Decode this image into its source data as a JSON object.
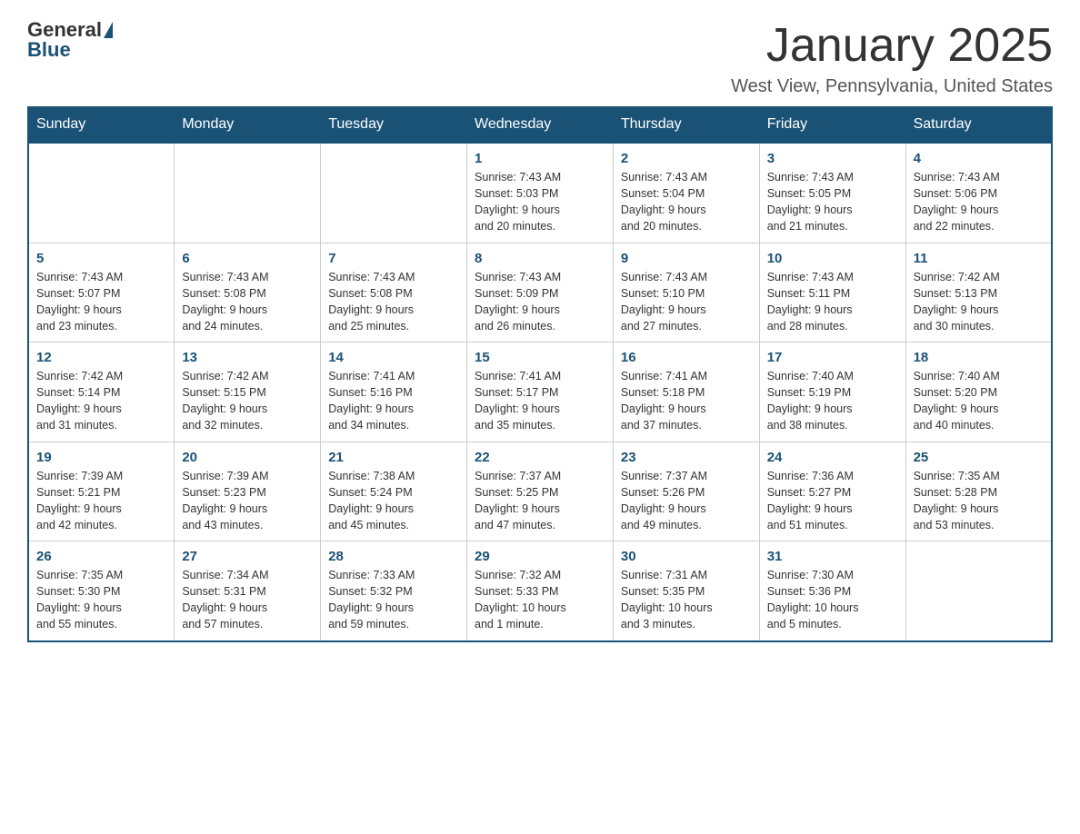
{
  "header": {
    "logo_general": "General",
    "logo_blue": "Blue",
    "title": "January 2025",
    "subtitle": "West View, Pennsylvania, United States"
  },
  "days_of_week": [
    "Sunday",
    "Monday",
    "Tuesday",
    "Wednesday",
    "Thursday",
    "Friday",
    "Saturday"
  ],
  "weeks": [
    [
      {
        "day": "",
        "info": ""
      },
      {
        "day": "",
        "info": ""
      },
      {
        "day": "",
        "info": ""
      },
      {
        "day": "1",
        "info": "Sunrise: 7:43 AM\nSunset: 5:03 PM\nDaylight: 9 hours\nand 20 minutes."
      },
      {
        "day": "2",
        "info": "Sunrise: 7:43 AM\nSunset: 5:04 PM\nDaylight: 9 hours\nand 20 minutes."
      },
      {
        "day": "3",
        "info": "Sunrise: 7:43 AM\nSunset: 5:05 PM\nDaylight: 9 hours\nand 21 minutes."
      },
      {
        "day": "4",
        "info": "Sunrise: 7:43 AM\nSunset: 5:06 PM\nDaylight: 9 hours\nand 22 minutes."
      }
    ],
    [
      {
        "day": "5",
        "info": "Sunrise: 7:43 AM\nSunset: 5:07 PM\nDaylight: 9 hours\nand 23 minutes."
      },
      {
        "day": "6",
        "info": "Sunrise: 7:43 AM\nSunset: 5:08 PM\nDaylight: 9 hours\nand 24 minutes."
      },
      {
        "day": "7",
        "info": "Sunrise: 7:43 AM\nSunset: 5:08 PM\nDaylight: 9 hours\nand 25 minutes."
      },
      {
        "day": "8",
        "info": "Sunrise: 7:43 AM\nSunset: 5:09 PM\nDaylight: 9 hours\nand 26 minutes."
      },
      {
        "day": "9",
        "info": "Sunrise: 7:43 AM\nSunset: 5:10 PM\nDaylight: 9 hours\nand 27 minutes."
      },
      {
        "day": "10",
        "info": "Sunrise: 7:43 AM\nSunset: 5:11 PM\nDaylight: 9 hours\nand 28 minutes."
      },
      {
        "day": "11",
        "info": "Sunrise: 7:42 AM\nSunset: 5:13 PM\nDaylight: 9 hours\nand 30 minutes."
      }
    ],
    [
      {
        "day": "12",
        "info": "Sunrise: 7:42 AM\nSunset: 5:14 PM\nDaylight: 9 hours\nand 31 minutes."
      },
      {
        "day": "13",
        "info": "Sunrise: 7:42 AM\nSunset: 5:15 PM\nDaylight: 9 hours\nand 32 minutes."
      },
      {
        "day": "14",
        "info": "Sunrise: 7:41 AM\nSunset: 5:16 PM\nDaylight: 9 hours\nand 34 minutes."
      },
      {
        "day": "15",
        "info": "Sunrise: 7:41 AM\nSunset: 5:17 PM\nDaylight: 9 hours\nand 35 minutes."
      },
      {
        "day": "16",
        "info": "Sunrise: 7:41 AM\nSunset: 5:18 PM\nDaylight: 9 hours\nand 37 minutes."
      },
      {
        "day": "17",
        "info": "Sunrise: 7:40 AM\nSunset: 5:19 PM\nDaylight: 9 hours\nand 38 minutes."
      },
      {
        "day": "18",
        "info": "Sunrise: 7:40 AM\nSunset: 5:20 PM\nDaylight: 9 hours\nand 40 minutes."
      }
    ],
    [
      {
        "day": "19",
        "info": "Sunrise: 7:39 AM\nSunset: 5:21 PM\nDaylight: 9 hours\nand 42 minutes."
      },
      {
        "day": "20",
        "info": "Sunrise: 7:39 AM\nSunset: 5:23 PM\nDaylight: 9 hours\nand 43 minutes."
      },
      {
        "day": "21",
        "info": "Sunrise: 7:38 AM\nSunset: 5:24 PM\nDaylight: 9 hours\nand 45 minutes."
      },
      {
        "day": "22",
        "info": "Sunrise: 7:37 AM\nSunset: 5:25 PM\nDaylight: 9 hours\nand 47 minutes."
      },
      {
        "day": "23",
        "info": "Sunrise: 7:37 AM\nSunset: 5:26 PM\nDaylight: 9 hours\nand 49 minutes."
      },
      {
        "day": "24",
        "info": "Sunrise: 7:36 AM\nSunset: 5:27 PM\nDaylight: 9 hours\nand 51 minutes."
      },
      {
        "day": "25",
        "info": "Sunrise: 7:35 AM\nSunset: 5:28 PM\nDaylight: 9 hours\nand 53 minutes."
      }
    ],
    [
      {
        "day": "26",
        "info": "Sunrise: 7:35 AM\nSunset: 5:30 PM\nDaylight: 9 hours\nand 55 minutes."
      },
      {
        "day": "27",
        "info": "Sunrise: 7:34 AM\nSunset: 5:31 PM\nDaylight: 9 hours\nand 57 minutes."
      },
      {
        "day": "28",
        "info": "Sunrise: 7:33 AM\nSunset: 5:32 PM\nDaylight: 9 hours\nand 59 minutes."
      },
      {
        "day": "29",
        "info": "Sunrise: 7:32 AM\nSunset: 5:33 PM\nDaylight: 10 hours\nand 1 minute."
      },
      {
        "day": "30",
        "info": "Sunrise: 7:31 AM\nSunset: 5:35 PM\nDaylight: 10 hours\nand 3 minutes."
      },
      {
        "day": "31",
        "info": "Sunrise: 7:30 AM\nSunset: 5:36 PM\nDaylight: 10 hours\nand 5 minutes."
      },
      {
        "day": "",
        "info": ""
      }
    ]
  ]
}
